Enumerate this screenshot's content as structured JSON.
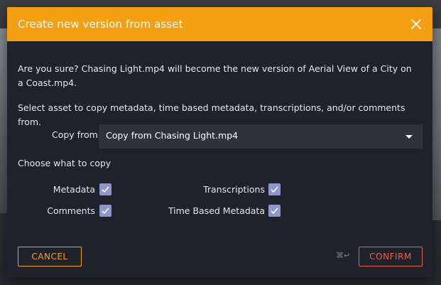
{
  "dialog": {
    "title": "Create new version from asset",
    "message": "Are you sure? Chasing Light.mp4 will become the new version of Aerial View of a City on a Coast.mp4.",
    "instruction": "Select asset to copy metadata, time based metadata, transcriptions, and/or comments from.",
    "copy_from": {
      "label": "Copy from",
      "selected": "Copy from Chasing Light.mp4"
    },
    "choose_label": "Choose what to copy",
    "options": {
      "metadata": {
        "label": "Metadata",
        "checked": true
      },
      "transcriptions": {
        "label": "Transcriptions",
        "checked": true
      },
      "comments": {
        "label": "Comments",
        "checked": true
      },
      "time_based_metadata": {
        "label": "Time Based Metadata",
        "checked": true
      }
    },
    "buttons": {
      "cancel": "CANCEL",
      "confirm": "CONFIRM",
      "shortcut": "⌘↵"
    }
  },
  "colors": {
    "accent": "#f5a013",
    "confirm": "#e5634f",
    "checkbox": "#8f96c9",
    "dialog_bg": "#1f222a"
  },
  "icons": {
    "close": "close-icon",
    "caret": "chevron-down-icon",
    "check": "check-icon"
  }
}
